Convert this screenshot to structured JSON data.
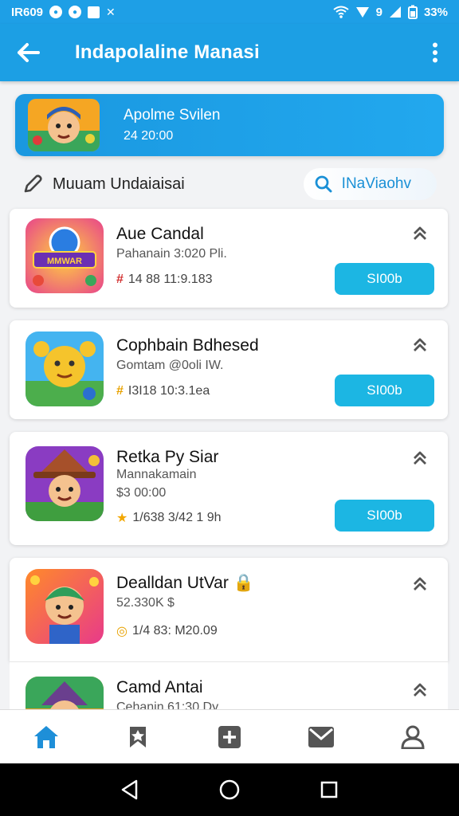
{
  "status_bar": {
    "time": "IR609",
    "battery": "33%",
    "signal_label": "9"
  },
  "app_bar": {
    "title": "Indapolaline Manasi"
  },
  "banner": {
    "title": "Apolme Svilen",
    "date": "24 20:00"
  },
  "section": {
    "title": "Muuam Undaiaisai",
    "nav_label": "INaViaohv"
  },
  "cards": [
    {
      "title": "Aue Candal",
      "subtitle": "Pahanain 3:020 Pli.",
      "meta": "14 88 11:9.183",
      "meta_icon": "#",
      "meta_color": "#d23030",
      "button": "SI00b"
    },
    {
      "title": "Cophbain Bdhesed",
      "subtitle": "Gomtam @0oli IW.",
      "meta": "I3I18 10:3.1ea",
      "meta_icon": "#",
      "meta_color": "#e8a200",
      "button": "SI00b"
    },
    {
      "title": "Retka Py Siar",
      "subtitle": "Mannakamain",
      "subtitle2": "$3 00:00",
      "meta": "1/638 3/42 1 9h",
      "meta_icon": "★",
      "meta_color": "#f2a700",
      "button": "SI00b"
    },
    {
      "title": "Dealldan UtVar",
      "subtitle": "52.330K $",
      "meta": "1/4 83: M20.09",
      "meta_icon": "◎",
      "meta_color": "#e8a200"
    },
    {
      "title": "Camd Antai",
      "subtitle": "Cehanin 61:30 Dy"
    }
  ],
  "colors": {
    "primary": "#1c9fe4",
    "button": "#1cb6e3",
    "nav_active": "#1e8fd8",
    "nav_inactive": "#555555"
  },
  "bottom_nav": [
    {
      "icon": "home-icon"
    },
    {
      "icon": "bookmark-icon"
    },
    {
      "icon": "plus-icon"
    },
    {
      "icon": "mail-icon"
    },
    {
      "icon": "profile-icon"
    }
  ]
}
